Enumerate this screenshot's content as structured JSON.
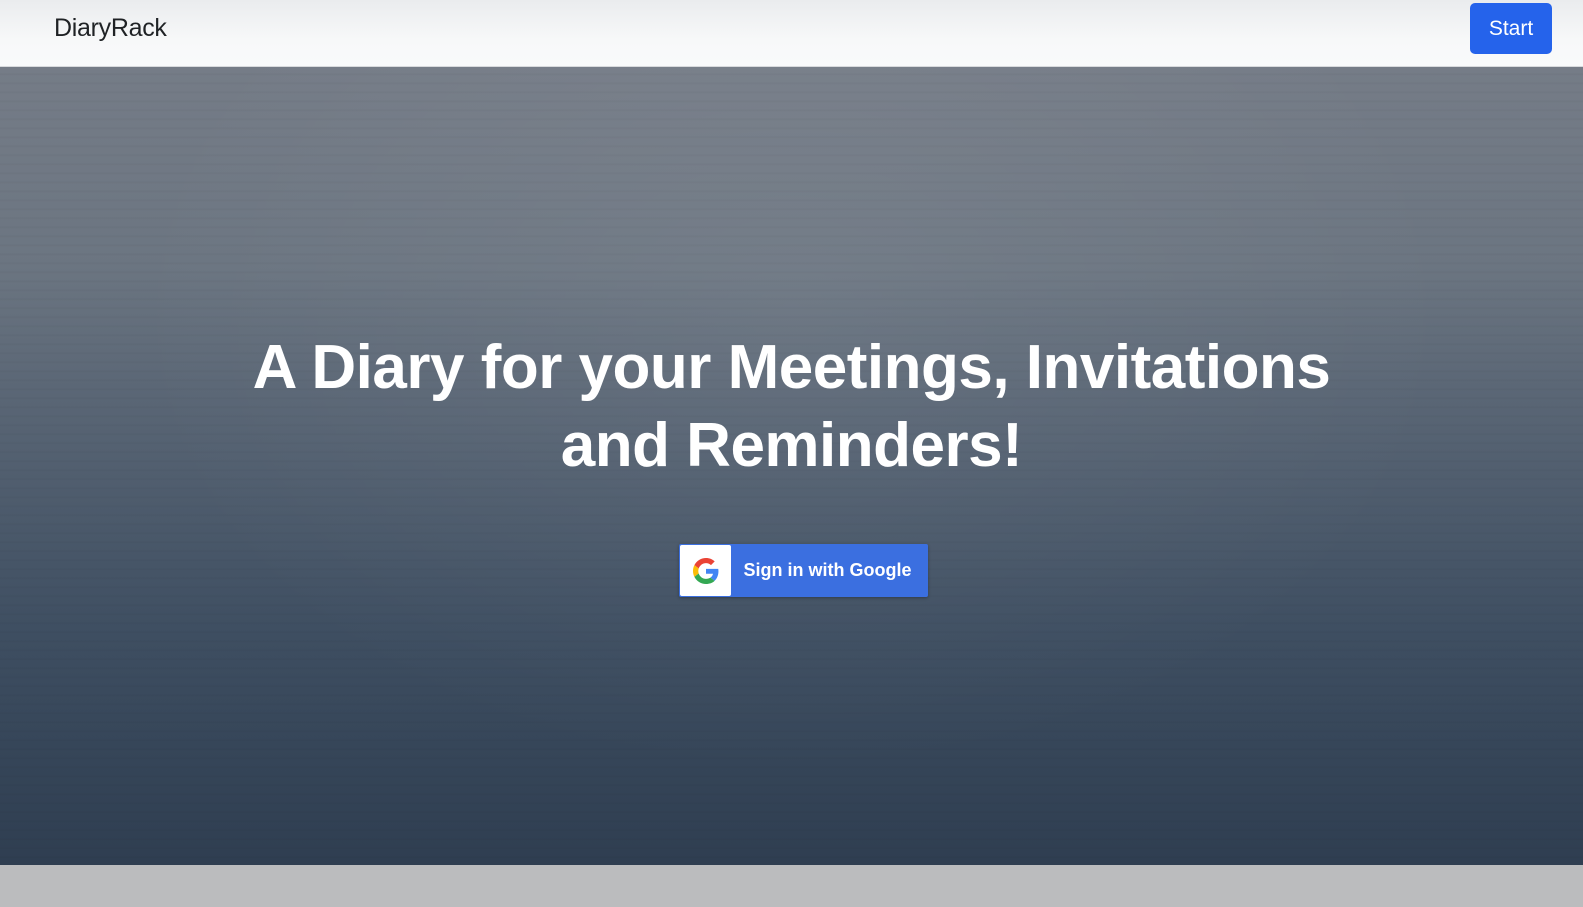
{
  "navbar": {
    "brand": "DiaryRack",
    "start_label": "Start"
  },
  "hero": {
    "headline_line1": "A Diary for your Meetings, Invitations",
    "headline_line2": "and Reminders!",
    "google_button_label": "Sign in with Google",
    "google_icon": "google-g-icon"
  },
  "colors": {
    "primary": "#2563eb",
    "google_button": "#3b6fe0",
    "headline": "#ffffff"
  }
}
